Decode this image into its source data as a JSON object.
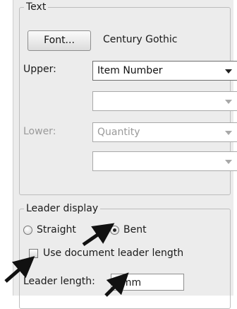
{
  "text_group": {
    "legend": "Text",
    "font_button_label": "Font...",
    "font_name": "Century Gothic",
    "upper_label": "Upper:",
    "upper_value": "Item Number",
    "upper_second_value": "",
    "lower_label": "Lower:",
    "lower_value": "Quantity",
    "lower_second_value": ""
  },
  "leader_group": {
    "legend": "Leader display",
    "straight_label": "Straight",
    "straight_selected": false,
    "bent_label": "Bent",
    "bent_selected": true,
    "use_document_label": "Use document leader length",
    "use_document_checked": false,
    "leader_length_label": "Leader length:",
    "leader_length_value": "6mm"
  },
  "colors": {
    "panel_bg": "#ececec",
    "arrow": "#111111"
  }
}
